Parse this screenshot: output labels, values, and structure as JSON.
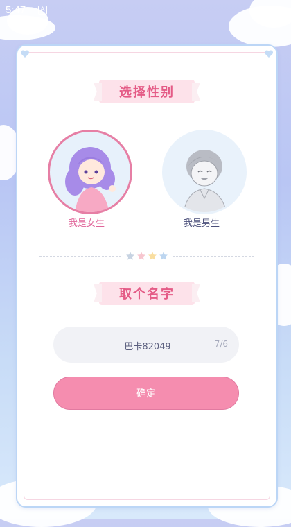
{
  "status_bar": {
    "time": "5:47",
    "notification_icon": "A"
  },
  "gender_section": {
    "title": "选择性别",
    "options": [
      {
        "label": "我是女生",
        "icon": "female-avatar",
        "selected": true
      },
      {
        "label": "我是男生",
        "icon": "male-avatar",
        "selected": false
      }
    ]
  },
  "name_section": {
    "title": "取个名字",
    "input_value": "巴卡82049",
    "char_counter": "7/6"
  },
  "confirm_label": "确定",
  "colors": {
    "accent_pink": "#f58daf",
    "title_pink": "#e45b86",
    "selected_border": "#e67fa5",
    "frame_blue": "#bcd6f6"
  }
}
